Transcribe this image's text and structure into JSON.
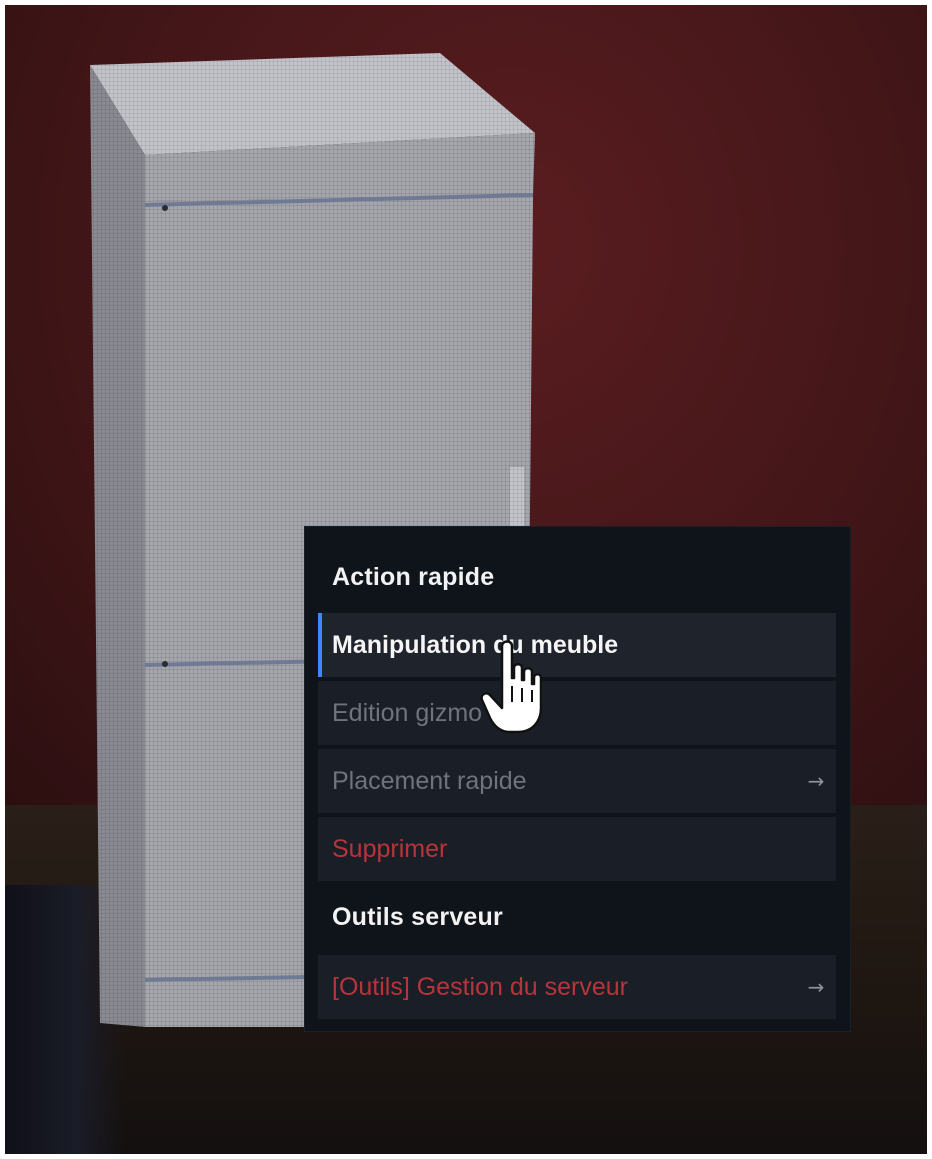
{
  "menu": {
    "sections": [
      {
        "title": "Action rapide",
        "items": [
          {
            "label": "Manipulation du meuble",
            "state": "active"
          },
          {
            "label": "Edition gizmo",
            "state": "disabled"
          },
          {
            "label": "Placement rapide",
            "state": "disabled",
            "arrow": "→"
          },
          {
            "label": "Supprimer",
            "state": "danger"
          }
        ]
      },
      {
        "title": "Outils serveur",
        "items": [
          {
            "label": "[Outils] Gestion du serveur",
            "state": "danger",
            "arrow": "→"
          }
        ]
      }
    ]
  },
  "colors": {
    "accent": "#3f86ff",
    "danger": "#b8343a",
    "menu_bg": "#0f131a",
    "item_bg": "#1a1f27",
    "disabled_text": "#6f737a"
  },
  "cursor": "hand-pointer-icon"
}
